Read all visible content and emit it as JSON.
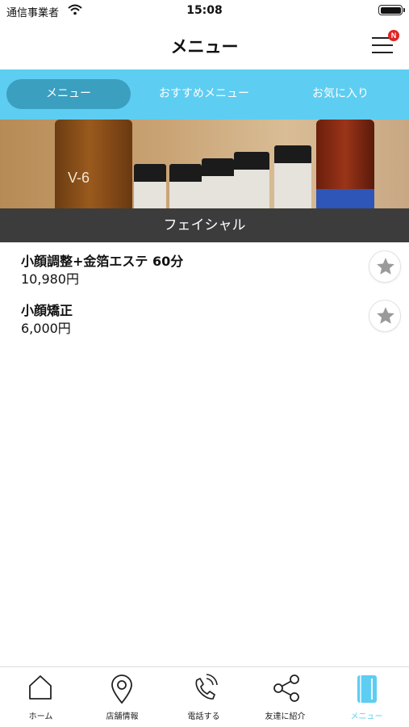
{
  "status_bar": {
    "carrier": "通信事業者",
    "time": "15:08"
  },
  "header": {
    "title": "メニュー",
    "badge": "N"
  },
  "tabs": [
    {
      "label": "メニュー",
      "active": true
    },
    {
      "label": "おすすめメニュー",
      "active": false
    },
    {
      "label": "お気に入り",
      "active": false
    }
  ],
  "banner": {
    "bottle_label": "V-6"
  },
  "section": {
    "title": "フェイシャル"
  },
  "menu_items": [
    {
      "name": "小顔調整+金箔エステ 60分",
      "price": "10,980円"
    },
    {
      "name": "小顔矯正",
      "price": "6,000円"
    }
  ],
  "bottom_nav": [
    {
      "label": "ホーム",
      "icon": "home-icon",
      "active": false
    },
    {
      "label": "店舗情報",
      "icon": "map-pin-icon",
      "active": false
    },
    {
      "label": "電話する",
      "icon": "phone-icon",
      "active": false
    },
    {
      "label": "友達に紹介",
      "icon": "share-icon",
      "active": false
    },
    {
      "label": "メニュー",
      "icon": "menu-book-icon",
      "active": true
    }
  ],
  "colors": {
    "accent": "#5ecdf2",
    "active_tab": "#3b9fc0",
    "section_bar": "#3c3c3c",
    "badge": "#e02424"
  }
}
